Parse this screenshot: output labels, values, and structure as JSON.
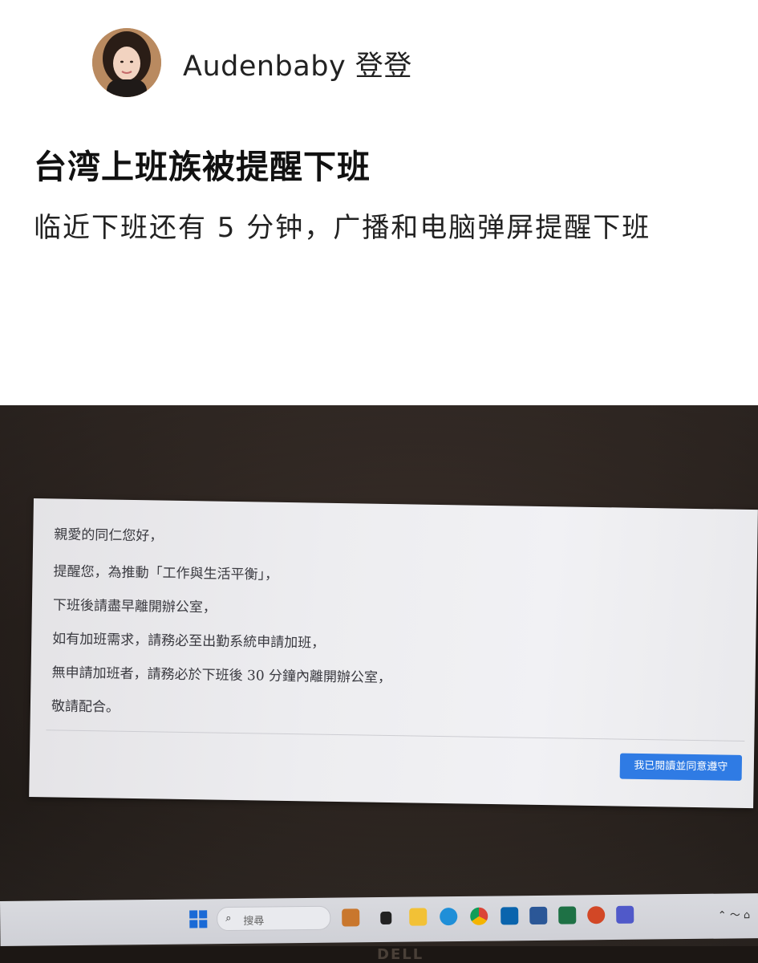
{
  "post": {
    "author": "Audenbaby 登登",
    "title": "台湾上班族被提醒下班",
    "subtitle": "临近下班还有 5 分钟，广播和电脑弹屏提醒下班"
  },
  "dialog": {
    "lines": [
      "親愛的同仁您好，",
      "提醒您，為推動「工作與生活平衡」，",
      "下班後請盡早離開辦公室，",
      "如有加班需求，請務必至出勤系統申請加班，",
      "無申請加班者，請務必於下班後 30 分鐘內離開辦公室，",
      "敬請配合。"
    ],
    "agree_button": "我已閱讀並同意遵守"
  },
  "taskbar": {
    "search_placeholder": "搜尋",
    "apps": [
      "windows-start-icon",
      "search-input",
      "work-briefcase-icon",
      "terminal-icon",
      "file-explorer-icon",
      "edge-icon",
      "chrome-icon",
      "outlook-icon",
      "word-icon",
      "excel-icon",
      "powerpoint-icon",
      "teams-icon"
    ]
  },
  "monitor": {
    "brand": "DELL"
  }
}
